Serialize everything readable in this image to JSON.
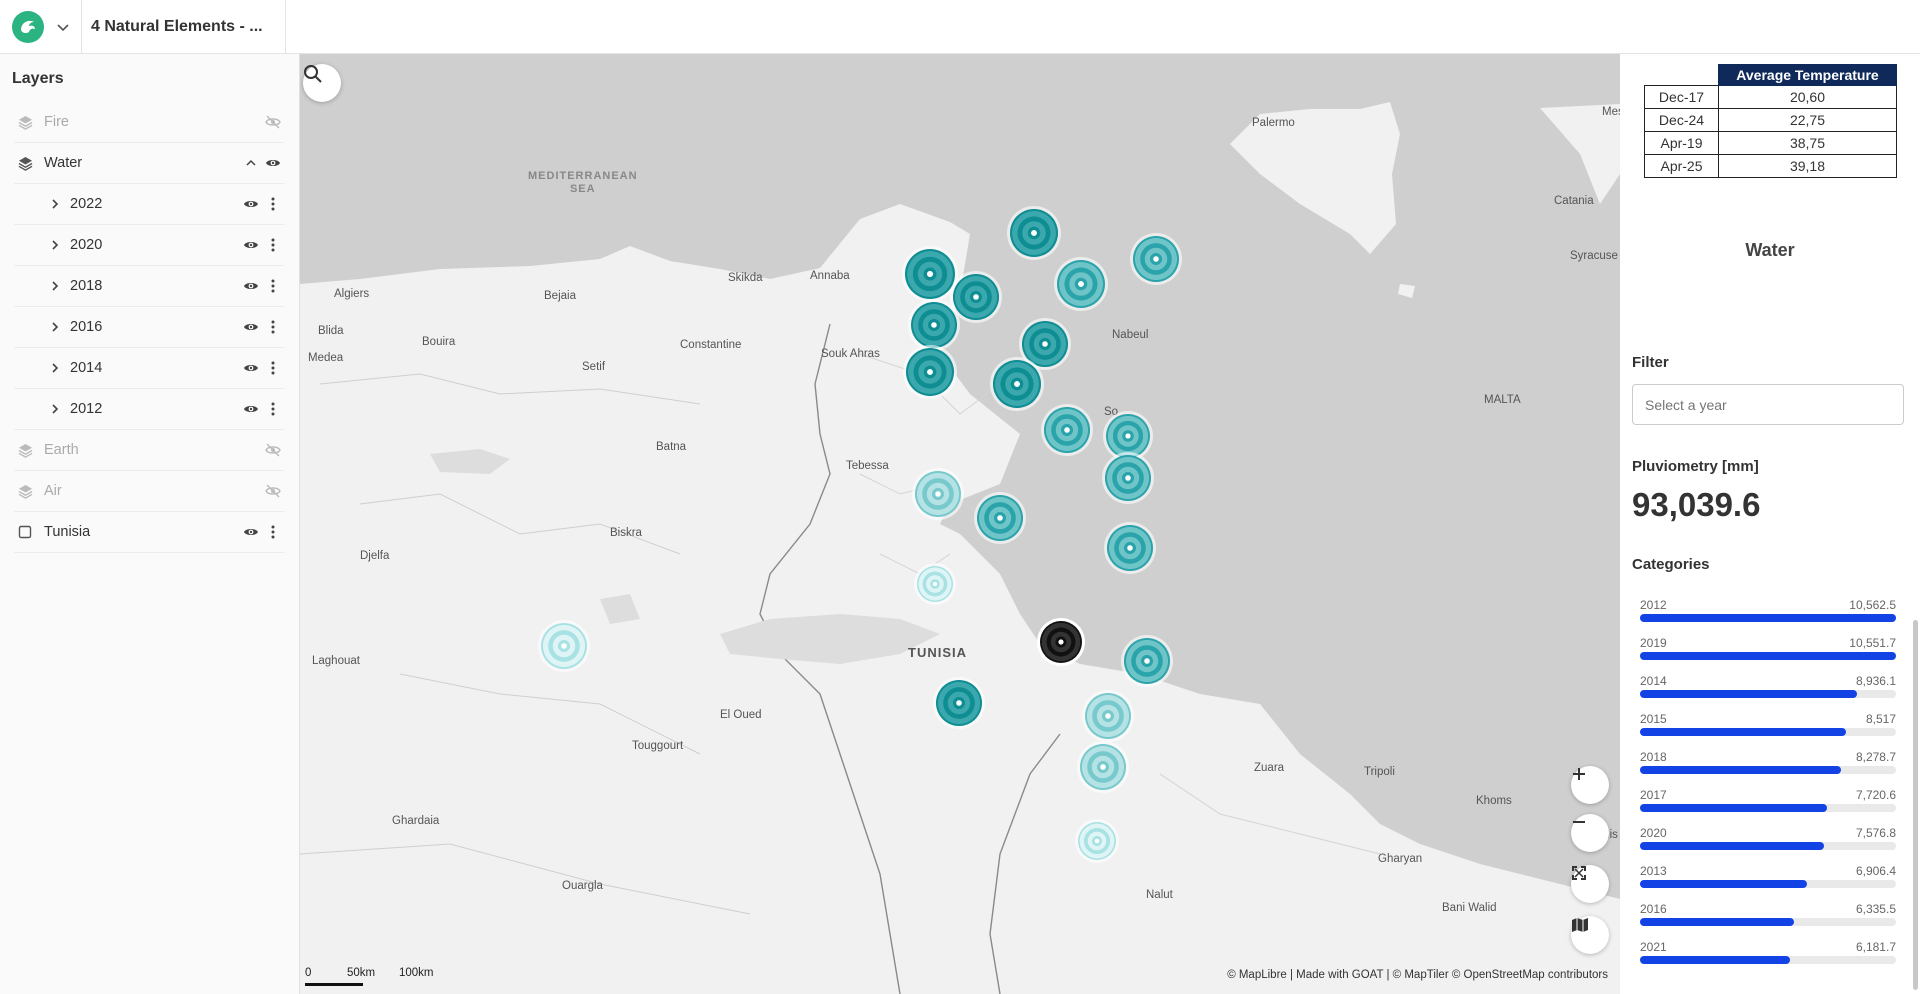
{
  "header": {
    "project_title": "4 Natural Elements - ..."
  },
  "layers_panel": {
    "title": "Layers",
    "groups": [
      {
        "label": "Fire",
        "visible": false
      },
      {
        "label": "Water",
        "visible": true,
        "expanded": true,
        "children": [
          "2022",
          "2020",
          "2018",
          "2016",
          "2014",
          "2012"
        ]
      },
      {
        "label": "Earth",
        "visible": false
      },
      {
        "label": "Air",
        "visible": false
      },
      {
        "label": "Tunisia",
        "visible": true
      }
    ]
  },
  "map": {
    "labels": {
      "palermo": "Palermo",
      "mes": "Mes",
      "catania": "Catania",
      "syracuse": "Syracuse",
      "malta": "MALTA",
      "algiers": "Algiers",
      "bejaia": "Bejaia",
      "skikda": "Skikda",
      "annaba": "Annaba",
      "blida": "Blida",
      "medea": "Medea",
      "bouira": "Bouira",
      "setif": "Setif",
      "constantine": "Constantine",
      "souk_ahras": "Souk Ahras",
      "nabeul": "Nabeul",
      "batna": "Batna",
      "tebessa": "Tebessa",
      "biskra": "Biskra",
      "djelfa": "Djelfa",
      "laghouat": "Laghouat",
      "el_oued": "El Oued",
      "touggourt": "Touggourt",
      "ghardaia": "Ghardaia",
      "ouargla": "Ouargla",
      "zuara": "Zuara",
      "tripoli": "Tripoli",
      "khoms": "Khoms",
      "mis": "Mis",
      "gharyan": "Gharyan",
      "bani_walid": "Bani Walid",
      "nalut": "Nalut",
      "so": "So"
    },
    "sea_label": [
      "MEDITERRANEAN",
      "SEA"
    ],
    "country_label": "TUNISIA",
    "scale": {
      "zero": "0",
      "mid": "50km",
      "end": "100km"
    },
    "attribution": "© MapLibre | Made with GOAT | © MapTiler © OpenStreetMap contributors"
  },
  "temperature_table": {
    "header": "Average Temperature",
    "rows": [
      {
        "date": "Dec-17",
        "value": "20,60"
      },
      {
        "date": "Dec-24",
        "value": "22,75"
      },
      {
        "date": "Apr-19",
        "value": "38,75"
      },
      {
        "date": "Apr-25",
        "value": "39,18"
      }
    ]
  },
  "stats_panel": {
    "title": "Water",
    "filter_label": "Filter",
    "filter_placeholder": "Select a year",
    "metric_label": "Pluviometry [mm]",
    "metric_value": "93,039.6",
    "categories_label": "Categories",
    "categories": [
      {
        "year": "2012",
        "value": "10,562.5",
        "fraction": 1.0
      },
      {
        "year": "2019",
        "value": "10,551.7",
        "fraction": 0.999
      },
      {
        "year": "2014",
        "value": "8,936.1",
        "fraction": 0.846
      },
      {
        "year": "2015",
        "value": "8,517",
        "fraction": 0.806
      },
      {
        "year": "2018",
        "value": "8,278.7",
        "fraction": 0.784
      },
      {
        "year": "2017",
        "value": "7,720.6",
        "fraction": 0.731
      },
      {
        "year": "2020",
        "value": "7,576.8",
        "fraction": 0.717
      },
      {
        "year": "2013",
        "value": "6,906.4",
        "fraction": 0.654
      },
      {
        "year": "2016",
        "value": "6,335.5",
        "fraction": 0.6
      },
      {
        "year": "2021",
        "value": "6,181.7",
        "fraction": 0.585
      }
    ]
  },
  "colors": {
    "accent": "#1443e5",
    "cluster_dark": "#0f8f95",
    "cluster_light": "#b9e8ea",
    "brand": "#2bb381"
  }
}
